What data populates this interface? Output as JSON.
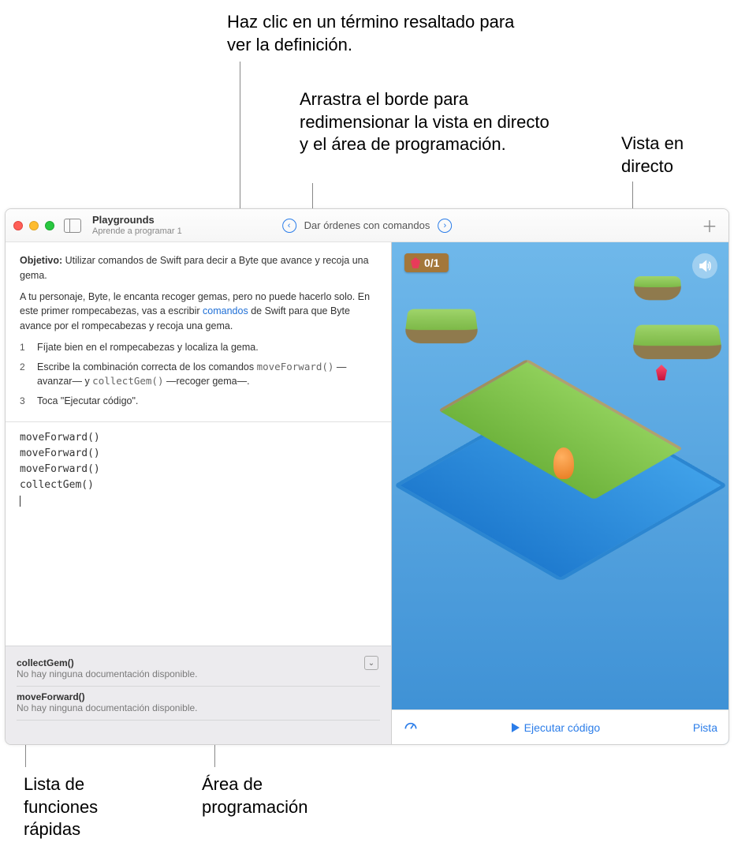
{
  "callouts": {
    "highlight_term": "Haz clic en un término resaltado para ver la definición.",
    "drag_border": "Arrastra el borde para redimensionar la vista en directo y el área de programación.",
    "live_view": "Vista en directo",
    "shortcuts_list": "Lista de funciones rápidas",
    "code_area": "Área de programación"
  },
  "titlebar": {
    "title": "Playgrounds",
    "subtitle": "Aprende a programar 1",
    "page_name": "Dar órdenes con comandos"
  },
  "instructions": {
    "objective_label": "Objetivo:",
    "objective_text": " Utilizar comandos de Swift para decir a Byte que avance y recoja una gema.",
    "paragraph_pre": "A tu personaje, Byte, le encanta recoger gemas, pero no puede hacerlo solo. En este primer rompecabezas, vas a escribir ",
    "link_word": "comandos",
    "paragraph_post": " de Swift para que Byte avance por el rompecabezas y recoja una gema.",
    "steps": {
      "s1": "Fíjate bien en el rompecabezas y localiza la gema.",
      "s2_pre": "Escribe la combinación correcta de los comandos ",
      "s2_cmd1": "moveForward()",
      "s2_mid1": " —avanzar— y ",
      "s2_cmd2": "collectGem()",
      "s2_mid2": " —recoger gema—.",
      "s3": "Toca \"Ejecutar código\"."
    }
  },
  "code": {
    "lines": [
      "moveForward()",
      "moveForward()",
      "moveForward()",
      "collectGem()"
    ]
  },
  "shortcuts": {
    "items": [
      {
        "name": "collectGem()",
        "desc": "No hay ninguna documentación disponible."
      },
      {
        "name": "moveForward()",
        "desc": "No hay ninguna documentación disponible."
      }
    ]
  },
  "scene": {
    "gem_counter": "0/1"
  },
  "bottombar": {
    "run_label": "Ejecutar código",
    "hint_label": "Pista"
  }
}
